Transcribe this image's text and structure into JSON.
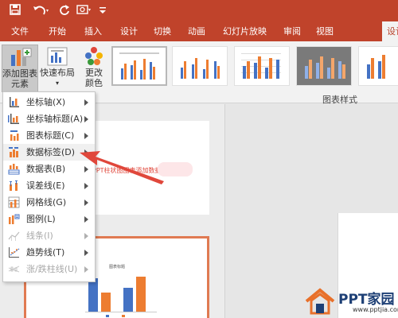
{
  "ribbon_tabs": [
    "文件",
    "开始",
    "插入",
    "设计",
    "切换",
    "动画",
    "幻灯片放映",
    "审阅",
    "视图",
    "设计"
  ],
  "ribbon": {
    "add_chart_element_line1": "添加图表",
    "add_chart_element_line2": "元素",
    "quick_layout": "快速布局",
    "change_color_line1": "更改",
    "change_color_line2": "颜色",
    "chart_styles_group": "图表样式"
  },
  "menu_items": [
    {
      "label": "坐标轴(X)",
      "icon": "axes-icon",
      "disabled": false
    },
    {
      "label": "坐标轴标题(A)",
      "icon": "axis-title-icon",
      "disabled": false
    },
    {
      "label": "图表标题(C)",
      "icon": "chart-title-icon",
      "disabled": false
    },
    {
      "label": "数据标签(D)",
      "icon": "data-labels-icon",
      "disabled": false
    },
    {
      "label": "数据表(B)",
      "icon": "data-table-icon",
      "disabled": false
    },
    {
      "label": "误差线(E)",
      "icon": "error-bars-icon",
      "disabled": false
    },
    {
      "label": "网格线(G)",
      "icon": "gridlines-icon",
      "disabled": false
    },
    {
      "label": "图例(L)",
      "icon": "legend-icon",
      "disabled": false
    },
    {
      "label": "线条(I)",
      "icon": "lines-icon",
      "disabled": true
    },
    {
      "label": "趋势线(T)",
      "icon": "trendline-icon",
      "disabled": false
    },
    {
      "label": "涨/跌柱线(U)",
      "icon": "up-down-bars-icon",
      "disabled": true
    }
  ],
  "slide_text": "PPT柱状图图表添加数据标签",
  "chart_title_small": "图表标题",
  "watermark": {
    "brand": "PPT家园",
    "url": "www.pptjia.com"
  },
  "colors": {
    "accent": "#c0432b",
    "bar_blue": "#4472c4",
    "bar_orange": "#ed7d31",
    "arrow": "#e0473b"
  }
}
